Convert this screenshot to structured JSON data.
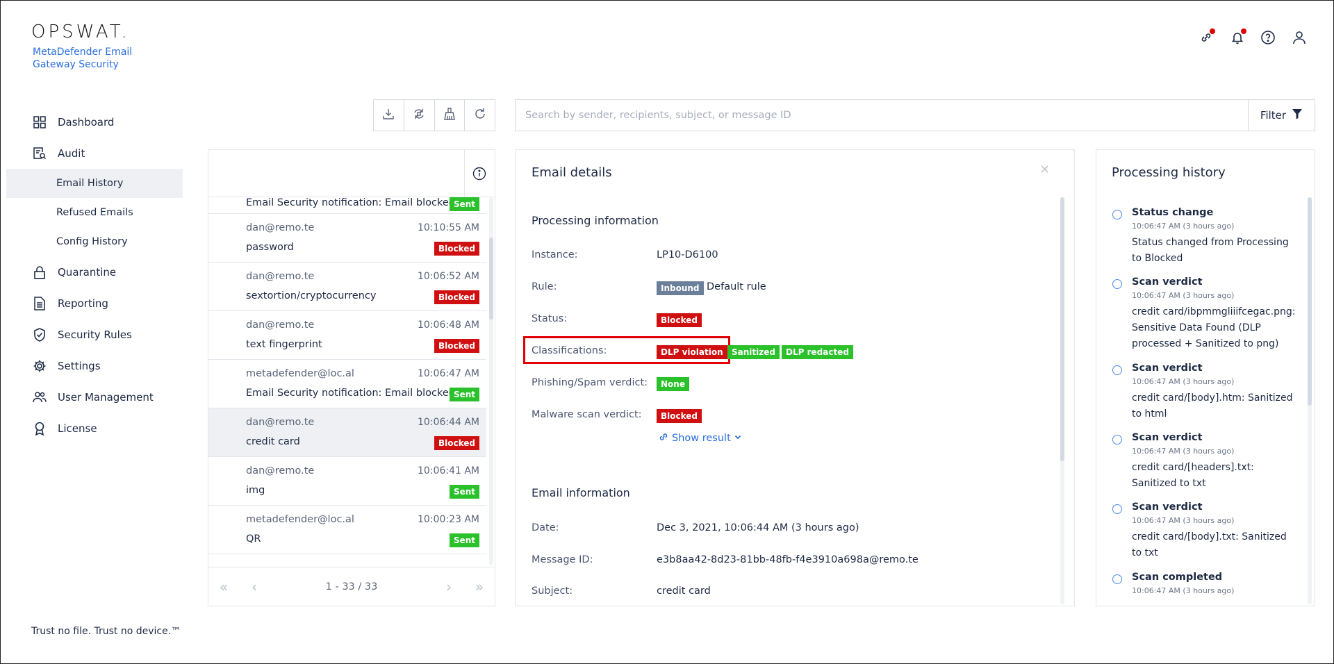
{
  "brand": {
    "logo": "OPSWAT.",
    "product": "MetaDefender Email Gateway Security"
  },
  "header_icons": [
    "link-icon",
    "bell-icon",
    "help-icon",
    "user-icon"
  ],
  "sidebar": {
    "items": [
      {
        "label": "Dashboard",
        "icon": "dashboard-icon"
      },
      {
        "label": "Audit",
        "icon": "audit-icon"
      },
      {
        "label": "Email History",
        "sub": true
      },
      {
        "label": "Refused Emails",
        "sub": true
      },
      {
        "label": "Config History",
        "sub": true
      },
      {
        "label": "Quarantine",
        "icon": "lock-icon"
      },
      {
        "label": "Reporting",
        "icon": "report-icon"
      },
      {
        "label": "Security Rules",
        "icon": "shield-icon"
      },
      {
        "label": "Settings",
        "icon": "gear-icon"
      },
      {
        "label": "User Management",
        "icon": "users-icon"
      },
      {
        "label": "License",
        "icon": "license-icon"
      }
    ],
    "footer": "Trust no file. Trust no device.™"
  },
  "search": {
    "placeholder": "Search by sender, recipients, subject, or message ID",
    "filter_label": "Filter"
  },
  "email_list": {
    "rows": [
      {
        "from": "",
        "time": "",
        "subject": "Email Security notification: Email blocked",
        "status": "Sent"
      },
      {
        "from": "dan@remo.te",
        "time": "10:10:55 AM",
        "subject": "password",
        "status": "Blocked"
      },
      {
        "from": "dan@remo.te",
        "time": "10:06:52 AM",
        "subject": "sextortion/cryptocurrency",
        "status": "Blocked"
      },
      {
        "from": "dan@remo.te",
        "time": "10:06:48 AM",
        "subject": "text fingerprint",
        "status": "Blocked"
      },
      {
        "from": "metadefender@loc.al",
        "time": "10:06:47 AM",
        "subject": "Email Security notification: Email blocked",
        "status": "Sent"
      },
      {
        "from": "dan@remo.te",
        "time": "10:06:44 AM",
        "subject": "credit card",
        "status": "Blocked"
      },
      {
        "from": "dan@remo.te",
        "time": "10:06:41 AM",
        "subject": "img",
        "status": "Sent"
      },
      {
        "from": "metadefender@loc.al",
        "time": "10:00:23 AM",
        "subject": "QR",
        "status": "Sent"
      }
    ],
    "pager": "1 - 33 / 33"
  },
  "details": {
    "title": "Email details",
    "processing": {
      "title": "Processing information",
      "instance_label": "Instance:",
      "instance": "LP10-D6100",
      "rule_label": "Rule:",
      "rule_badge": "Inbound",
      "rule": "Default rule",
      "status_label": "Status:",
      "status": "Blocked",
      "class_label": "Classifications:",
      "class_badges": [
        "DLP violation",
        "Sanitized",
        "DLP redacted"
      ],
      "phish_label": "Phishing/Spam verdict:",
      "phish": "None",
      "malware_label": "Malware scan verdict:",
      "malware": "Blocked",
      "show_result": "Show result"
    },
    "email_info": {
      "title": "Email information",
      "date_label": "Date:",
      "date": "Dec 3, 2021, 10:06:44 AM (3 hours ago)",
      "msgid_label": "Message ID:",
      "msgid": "e3b8aa42-8d23-81bb-48fb-f4e3910a698a@remo.te",
      "subject_label": "Subject:",
      "subject": "credit card"
    }
  },
  "history": {
    "title": "Processing history",
    "items": [
      {
        "title": "Status change",
        "time": "10:06:47 AM (3 hours ago)",
        "text": "Status changed from Processing to Blocked"
      },
      {
        "title": "Scan verdict",
        "time": "10:06:47 AM (3 hours ago)",
        "text": "credit card/ibpmmgliiifcegac.png: Sensitive Data Found (DLP processed + Sanitized to png)"
      },
      {
        "title": "Scan verdict",
        "time": "10:06:47 AM (3 hours ago)",
        "text": "credit card/[body].htm: Sanitized to html"
      },
      {
        "title": "Scan verdict",
        "time": "10:06:47 AM (3 hours ago)",
        "text": "credit card/[headers].txt: Sanitized to txt"
      },
      {
        "title": "Scan verdict",
        "time": "10:06:47 AM (3 hours ago)",
        "text": "credit card/[body].txt: Sanitized to txt"
      },
      {
        "title": "Scan completed",
        "time": "10:06:47 AM (3 hours ago)",
        "text": ""
      }
    ]
  }
}
